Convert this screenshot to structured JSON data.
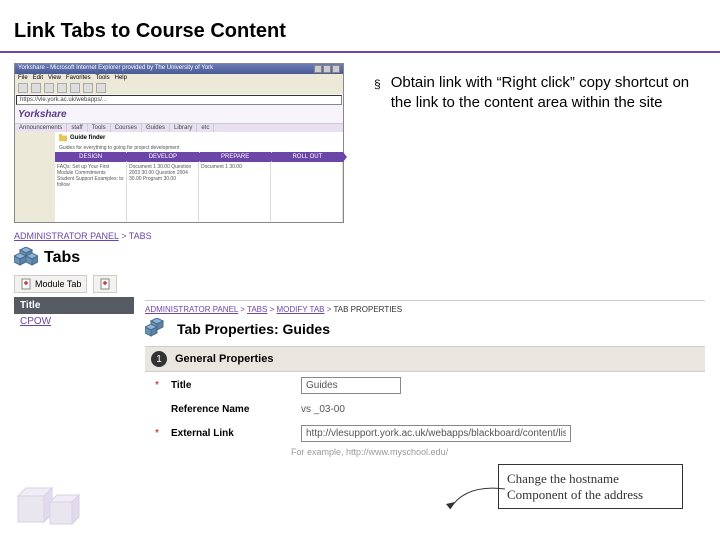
{
  "slide": {
    "title": "Link Tabs to Course Content"
  },
  "bullet": {
    "marker": "§",
    "text": "Obtain link with “Right click” copy shortcut on the link to the content area within the site"
  },
  "browser": {
    "title_prefix": "Yorkshare - Microsoft Internet Explorer provided by The University of York",
    "menu": [
      "File",
      "Edit",
      "View",
      "Favorites",
      "Tools",
      "Help"
    ],
    "address": "https://vle.york.ac.uk/webapps/...",
    "brand": "Yorkshare",
    "tabs": [
      "Announcements",
      "staff",
      "Tools",
      "Courses",
      "Guides",
      "Library",
      "etc"
    ],
    "guide_finder_label": "Guide finder",
    "guide_finder_sub": "Guides for everything to going for project development",
    "phases": [
      "DESIGN",
      "DEVELOP",
      "PREPARE",
      "ROLL OUT"
    ],
    "phase_bodies": [
      "FAQs: Set up\nYour First\nModule Commitments\nStudent Support\nExamples: to follow",
      "Document 1\n30.00\nQuestion 2003\n30.00\nQuestion 2004\n30.00\nProgram\n30.00",
      "Document 1\n30.00",
      ""
    ]
  },
  "admin": {
    "breadcrumb_root": "ADMINISTRATOR PANEL",
    "breadcrumb_leaf": "TABS",
    "page_title": "Tabs",
    "btn_module": "Module Tab",
    "btn_other": "",
    "col_title": "Title",
    "row0": "CPOW"
  },
  "props": {
    "breadcrumb": [
      "ADMINISTRATOR PANEL",
      "TABS",
      "MODIFY TAB",
      "TAB PROPERTIES"
    ],
    "page_title": "Tab Properties: Guides",
    "section_num": "1",
    "section_title": "General Properties",
    "field_title_label": "Title",
    "field_title_value": "Guides",
    "field_refname_label": "Reference Name",
    "field_refname_value": "vs _03-00",
    "field_extlink_label": "External Link",
    "field_extlink_value": "http://vlesupport.york.ac.uk/webapps/blackboard/content/listConten",
    "example_text": "For example, http://www.myschool.edu/"
  },
  "callout": {
    "text": "Change the hostname Component of the address"
  }
}
